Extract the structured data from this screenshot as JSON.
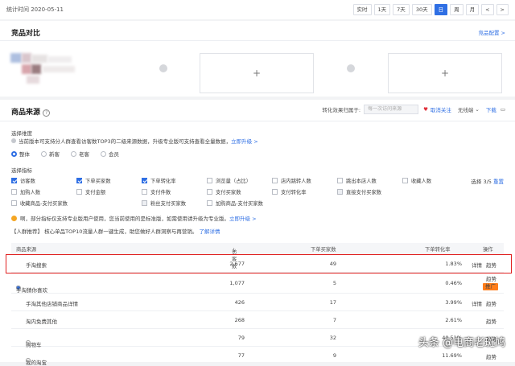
{
  "topbar": {
    "stat_time": "统计时间 2020-05-11",
    "ranges": [
      {
        "label": "实时"
      },
      {
        "label": "1天"
      },
      {
        "label": "7天"
      },
      {
        "label": "30天"
      },
      {
        "label": "日"
      },
      {
        "label": "周"
      },
      {
        "label": "月"
      },
      {
        "label": "<"
      },
      {
        "label": ">"
      }
    ],
    "active_range": "日"
  },
  "compare": {
    "title": "竞品对比",
    "config_link": "竞品配置 >",
    "add_symbol": "+"
  },
  "source": {
    "title": "商品来源",
    "help_icon": "?",
    "attribution_label": "转化效果归属于:",
    "attribution_placeholder": "每一次访问来源",
    "follow_link": "取消关注",
    "no_wireless": "无线端",
    "download": "下载",
    "dimension_label": "选择维度",
    "dimension_tip": "当前版本可支持分人群查看访客数TOP3的二级来源数据，升级专业版可支持查看全量数据，",
    "upgrade_link": "立即升级 >",
    "audiences": [
      {
        "label": "整体",
        "checked": true
      },
      {
        "label": "新客",
        "checked": false
      },
      {
        "label": "老客",
        "checked": false
      },
      {
        "label": "会员",
        "checked": false
      }
    ],
    "metric_label": "选择指标",
    "metrics_row1": [
      {
        "label": "访客数",
        "state": "on"
      },
      {
        "label": "下单买家数",
        "state": "on"
      },
      {
        "label": "下单转化率",
        "state": "on"
      },
      {
        "label": "浏览量（占比）",
        "state": "off"
      },
      {
        "label": "店内跳转人数",
        "state": "off"
      },
      {
        "label": "跳出本店人数",
        "state": "off"
      },
      {
        "label": "收藏人数",
        "state": "off"
      }
    ],
    "metrics_row2": [
      {
        "label": "加购人数",
        "state": "off"
      },
      {
        "label": "支付金额",
        "state": "off"
      },
      {
        "label": "支付件数",
        "state": "off"
      },
      {
        "label": "支付买家数",
        "state": "off"
      },
      {
        "label": "支付转化率",
        "state": "off"
      },
      {
        "label": "直接支付买家数",
        "state": "dis"
      }
    ],
    "metrics_row3": [
      {
        "label": "收藏商品-支付买家数",
        "state": "off"
      },
      {
        "label": "粉丝支付买家数",
        "state": "dis"
      },
      {
        "label": "加购商品-支付买家数",
        "state": "off"
      }
    ],
    "select_count": "选择 3/5",
    "reset": "重置",
    "notice": "啊，部分指标仅支持专业版用户使用，您当前使用的是标准版，如需使用请升级为专业版。",
    "notice_link": "立即升级 >",
    "crowd_tag": "【人群推荐】",
    "crowd_text": "核心单品TOP10流量人群一键生成，助您做好人群洞察与再营销。",
    "crowd_link": "了解详情",
    "table": {
      "headers": [
        "商品来源",
        "访客数",
        "下单买家数",
        "下单转化率",
        "操作"
      ],
      "sort_icon": "↓",
      "rows": [
        {
          "source": "手淘搜索",
          "visitors": "2,677",
          "buyers": "49",
          "rate": "1.83%",
          "actions": [
            "详情",
            "趋势"
          ]
        },
        {
          "source": "手淘猜你喜欢",
          "visitors": "1,077",
          "buyers": "5",
          "rate": "0.46%",
          "actions": [
            "趋势"
          ],
          "badge": "推广"
        },
        {
          "source": "手淘其他店铺商品详情",
          "visitors": "426",
          "buyers": "17",
          "rate": "3.99%",
          "actions": [
            "详情",
            "趋势"
          ]
        },
        {
          "source": "淘内免费其他",
          "visitors": "268",
          "buyers": "7",
          "rate": "2.61%",
          "actions": [
            "趋势"
          ]
        },
        {
          "source": "购物车",
          "visitors": "79",
          "buyers": "32",
          "rate": "40.51%",
          "actions": [
            "趋势"
          ]
        },
        {
          "source": "我的淘宝",
          "visitors": "77",
          "buyers": "9",
          "rate": "11.69%",
          "actions": [
            "趋势"
          ]
        }
      ]
    }
  },
  "watermark": "头条 @电商老斑鸠",
  "colors": {
    "accent": "#2f6fe4",
    "highlight": "#e02020",
    "badge": "#ff7d1a"
  }
}
